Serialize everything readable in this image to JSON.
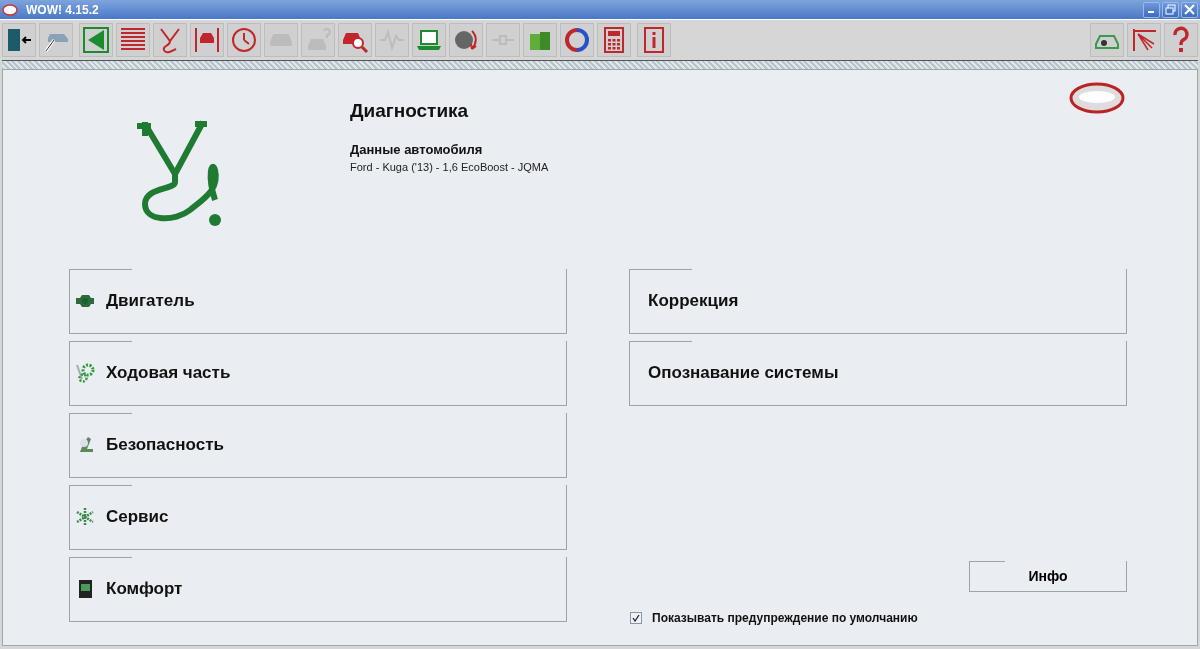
{
  "window": {
    "title": "WOW! 4.15.2"
  },
  "toolbar": {
    "groups": [
      [
        {
          "kind": "exit",
          "disabled": false
        },
        {
          "kind": "carpointer",
          "disabled": false
        }
      ],
      [
        {
          "kind": "back",
          "disabled": false
        },
        {
          "kind": "list",
          "disabled": false
        },
        {
          "kind": "stethoscope",
          "disabled": false
        },
        {
          "kind": "lift",
          "disabled": false
        },
        {
          "kind": "clock",
          "disabled": false
        },
        {
          "kind": "car",
          "disabled": true
        },
        {
          "kind": "carquestion",
          "disabled": true
        },
        {
          "kind": "carsearch",
          "disabled": false
        },
        {
          "kind": "wave",
          "disabled": true
        },
        {
          "kind": "laptop",
          "disabled": false
        },
        {
          "kind": "globe",
          "disabled": false
        },
        {
          "kind": "plug",
          "disabled": true
        },
        {
          "kind": "boxes",
          "disabled": false
        },
        {
          "kind": "sync",
          "disabled": false
        },
        {
          "kind": "calculator",
          "disabled": false
        }
      ],
      [
        {
          "kind": "info",
          "disabled": false
        }
      ]
    ],
    "right": [
      {
        "kind": "eurocar",
        "disabled": false
      },
      {
        "kind": "graph",
        "disabled": false
      },
      {
        "kind": "help",
        "disabled": false
      }
    ]
  },
  "header": {
    "title": "Диагностика",
    "vehicle_label": "Данные автомобиля",
    "vehicle": "Ford - Kuga ('13) - 1,6 EcoBoost - JQMA"
  },
  "categories": [
    {
      "label": "Двигатель",
      "kind": "engine"
    },
    {
      "label": "Ходовая часть",
      "kind": "chassis"
    },
    {
      "label": "Безопасность",
      "kind": "safety"
    },
    {
      "label": "Сервис",
      "kind": "service"
    },
    {
      "label": "Комфорт",
      "kind": "comfort"
    }
  ],
  "functions": [
    {
      "label": "Коррекция"
    },
    {
      "label": "Опознавание системы"
    }
  ],
  "info_button": "Инфо",
  "default_warning": {
    "label": "Показывать предупреждение по умолчанию",
    "checked": true
  }
}
